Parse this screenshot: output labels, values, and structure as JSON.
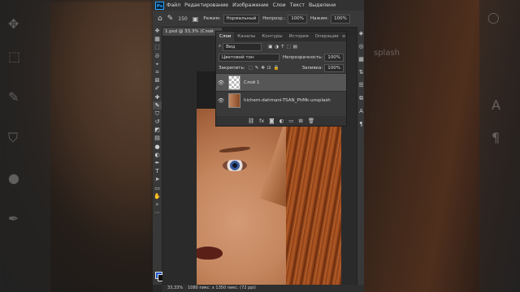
{
  "app": {
    "logo": "Ps",
    "menu": [
      "Файл",
      "Редактирование",
      "Изображение",
      "Слои",
      "Текст",
      "Выделени"
    ]
  },
  "options_bar": {
    "brush_size": "150",
    "mode_label": "Режим:",
    "mode_value": "Нормальный",
    "opacity_label": "Непрозр.:",
    "opacity_value": "100%",
    "pressure_label": "Нажим:",
    "pressure_value": "100%"
  },
  "document": {
    "tab_title": "1.psd @ 33,3% (Слой",
    "zoom": "33,33%",
    "dimensions": "1080 пикс. x 1350 пикс. (72 ppi)"
  },
  "layers_panel": {
    "tabs": [
      "Слои",
      "Каналы",
      "Контуры",
      "История",
      "Операции"
    ],
    "filter_label": "Вид",
    "blend_mode": "Цветовой тон",
    "opacity_label": "Непрозрачность:",
    "opacity_value": "100%",
    "lock_label": "Закрепить:",
    "fill_label": "Заливка:",
    "fill_value": "100%",
    "layers": [
      {
        "name": "Слой 1",
        "selected": true,
        "thumb": "transparent"
      },
      {
        "name": "hichem-dahmani-TSAN_PhMk-unsplash",
        "selected": false,
        "thumb": "photo"
      }
    ],
    "footer_icons": [
      "link-icon",
      "fx-icon",
      "mask-icon",
      "adjustment-icon",
      "group-icon",
      "new-layer-icon",
      "trash-icon"
    ]
  },
  "background_text": {
    "right_snippet": "splash"
  },
  "colors": {
    "foreground": "#1a56c8",
    "background": "#111111",
    "ps_blue": "#31a8ff"
  }
}
